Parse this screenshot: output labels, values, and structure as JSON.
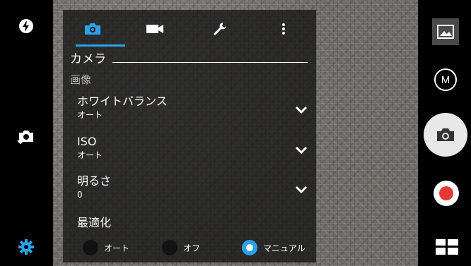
{
  "panel": {
    "tabs": [
      {
        "icon": "camera-icon",
        "active": true
      },
      {
        "icon": "video-camera-icon",
        "active": false
      },
      {
        "icon": "wrench-icon",
        "active": false
      },
      {
        "icon": "more-vertical-icon",
        "active": false
      }
    ],
    "section_title": "カメラ",
    "subsection_title": "画像",
    "rows": [
      {
        "label": "ホワイトバランス",
        "value": "オート"
      },
      {
        "label": "ISO",
        "value": "オート"
      },
      {
        "label": "明るさ",
        "value": "0"
      }
    ],
    "optimize": {
      "label": "最適化",
      "options": [
        {
          "label": "オート",
          "selected": false
        },
        {
          "label": "オフ",
          "selected": false
        },
        {
          "label": "マニュアル",
          "selected": true
        }
      ]
    }
  },
  "left_bar": {
    "icons": [
      "flash-auto-icon",
      "switch-camera-icon",
      "settings-gear-icon"
    ]
  },
  "right_bar": {
    "mode_label": "M",
    "icons": [
      "gallery-thumbnail-icon",
      "mode-button",
      "shutter-camera-icon",
      "record-video-icon",
      "grid-menu-icon"
    ]
  },
  "colors": {
    "accent": "#29a3e8",
    "record": "#e53935",
    "panel_bg": "rgba(20,20,20,0.78)"
  }
}
